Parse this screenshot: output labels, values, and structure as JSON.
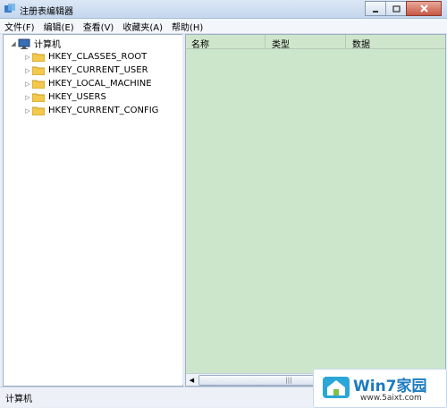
{
  "window": {
    "title": "注册表编辑器"
  },
  "menu": {
    "items": [
      "文件(F)",
      "编辑(E)",
      "查看(V)",
      "收藏夹(A)",
      "帮助(H)"
    ]
  },
  "tree": {
    "root": "计算机",
    "hives": [
      "HKEY_CLASSES_ROOT",
      "HKEY_CURRENT_USER",
      "HKEY_LOCAL_MACHINE",
      "HKEY_USERS",
      "HKEY_CURRENT_CONFIG"
    ]
  },
  "list": {
    "columns": [
      "名称",
      "类型",
      "数据"
    ]
  },
  "status": {
    "text": "计算机"
  },
  "watermark": {
    "brand": "Win7家园",
    "url": "www.5aixt.com"
  },
  "colors": {
    "list_bg": "#cce6cc",
    "folder": "#f2c94c",
    "brand": "#1d7bbf"
  }
}
